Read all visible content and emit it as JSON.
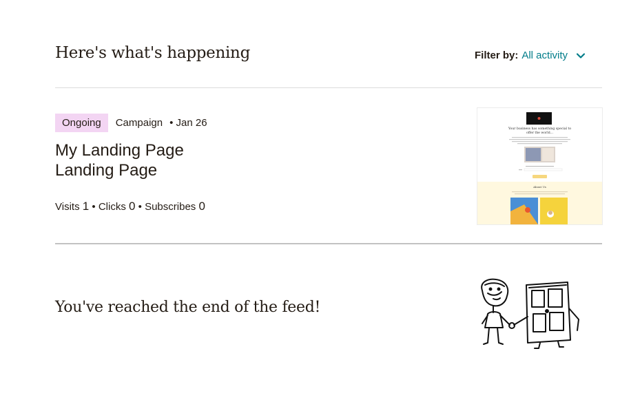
{
  "header": {
    "title": "Here's what's happening",
    "filter_label": "Filter by:",
    "filter_value": "All activity",
    "filter_icon": "chevron-down-icon"
  },
  "feed": {
    "items": [
      {
        "status": "Ongoing",
        "type": "Campaign",
        "date": "• Jan 26",
        "title_line1": "My Landing Page",
        "title_line2": "Landing Page",
        "stats": {
          "visits_label": "Visits",
          "visits": "1",
          "clicks_label": "Clicks",
          "clicks": "0",
          "subscribes_label": "Subscribes",
          "subscribes": "0",
          "separator": "•"
        },
        "thumbnail": {
          "headline_line1": "Your business has something special to",
          "headline_line2": "offer the world...",
          "section_title": "About Us"
        }
      }
    ],
    "end_message": "You've reached the end of the feed!"
  },
  "colors": {
    "accent": "#007c89",
    "badge_bg": "#f3d5f3",
    "text": "#241c15"
  }
}
